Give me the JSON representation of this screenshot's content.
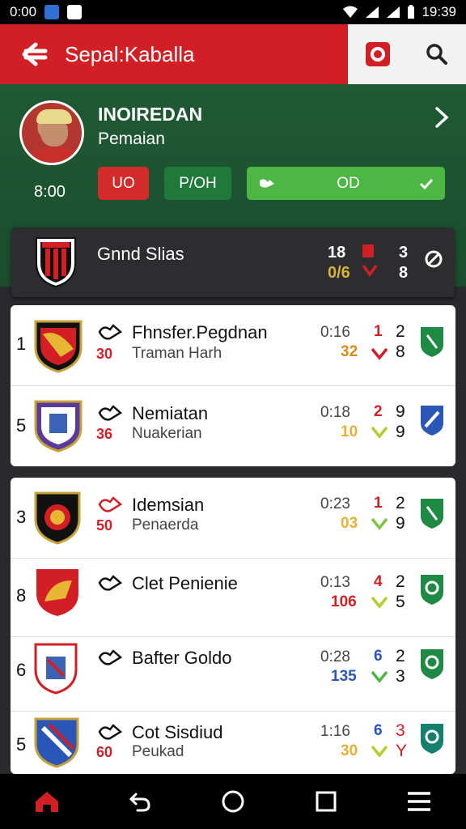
{
  "status": {
    "time_left": "0:00",
    "time_right": "19:39"
  },
  "app_bar": {
    "title": "Sepal:Kaballa"
  },
  "profile": {
    "name": "INOIREDAN",
    "role": "Pemaian",
    "time": "8:00",
    "btn_red": "UO",
    "btn_green": "P/OH",
    "btn_wide": "OD"
  },
  "group": {
    "name": "Gnnd Slias",
    "n1": "18",
    "n2": "0/6",
    "n3": "3",
    "n4": "8"
  },
  "rows": [
    {
      "rank": "1",
      "name": "Fhnsfer.Pegdnan",
      "num": "30",
      "sub": "Traman Harh",
      "time": "0:16",
      "stat_top": "1",
      "stat_bottom": "32",
      "right_top": "2",
      "right_bottom": "8"
    },
    {
      "rank": "5",
      "name": "Nemiatan",
      "num": "36",
      "sub": "Nuakerian",
      "time": "0:18",
      "stat_top": "2",
      "stat_bottom": "10",
      "right_top": "9",
      "right_bottom": "9"
    },
    {
      "rank": "3",
      "name": "Idemsian",
      "num": "50",
      "sub": "Penaerda",
      "time": "0:23",
      "stat_top": "1",
      "stat_bottom": "03",
      "right_top": "2",
      "right_bottom": "9"
    },
    {
      "rank": "8",
      "name": "Clet Penienie",
      "num": "",
      "sub": "",
      "time": "0:13",
      "stat_top": "4",
      "stat_bottom": "106",
      "right_top": "2",
      "right_bottom": "5"
    },
    {
      "rank": "6",
      "name": "Bafter Goldo",
      "num": "",
      "sub": "",
      "time": "0:28",
      "stat_top": "6",
      "stat_bottom": "135",
      "right_top": "2",
      "right_bottom": "3"
    },
    {
      "rank": "5",
      "name": "Cot Sisdiud",
      "num": "60",
      "sub": "Peukad",
      "time": "1:16",
      "stat_top": "6",
      "stat_bottom": "30",
      "right_top": "3",
      "right_bottom": "Y"
    }
  ],
  "colors": {
    "red": "#d21f26",
    "green": "#1f5a34",
    "bright_green": "#4db744"
  }
}
